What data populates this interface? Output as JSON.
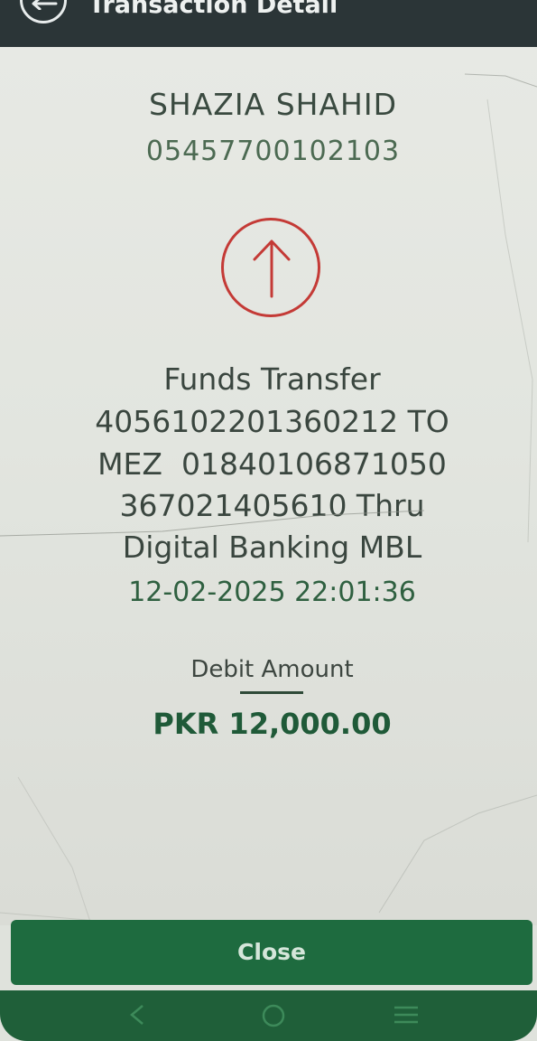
{
  "header": {
    "title": "Transaction Detail",
    "back_icon": "arrow-left-icon"
  },
  "account": {
    "name": "SHAZIA SHAHID",
    "number": "05457700102103"
  },
  "transaction": {
    "direction_icon": "arrow-up-icon",
    "direction_color": "#c43a36",
    "description_lines": [
      "Funds Transfer",
      "4056102201360212 TO",
      "MEZ  01840106871050",
      "367021405610 Thru",
      "Digital Banking MBL"
    ],
    "datetime": "12-02-2025 22:01:36",
    "amount_label": "Debit Amount",
    "amount": "PKR 12,000.00"
  },
  "actions": {
    "close_label": "Close"
  },
  "navigation": {
    "buttons": [
      "back-nav-icon",
      "home-nav-icon",
      "menu-nav-icon"
    ]
  },
  "colors": {
    "app_bar": "#2b3537",
    "primary_green": "#1e6b3f",
    "text_green": "#2f6040"
  }
}
